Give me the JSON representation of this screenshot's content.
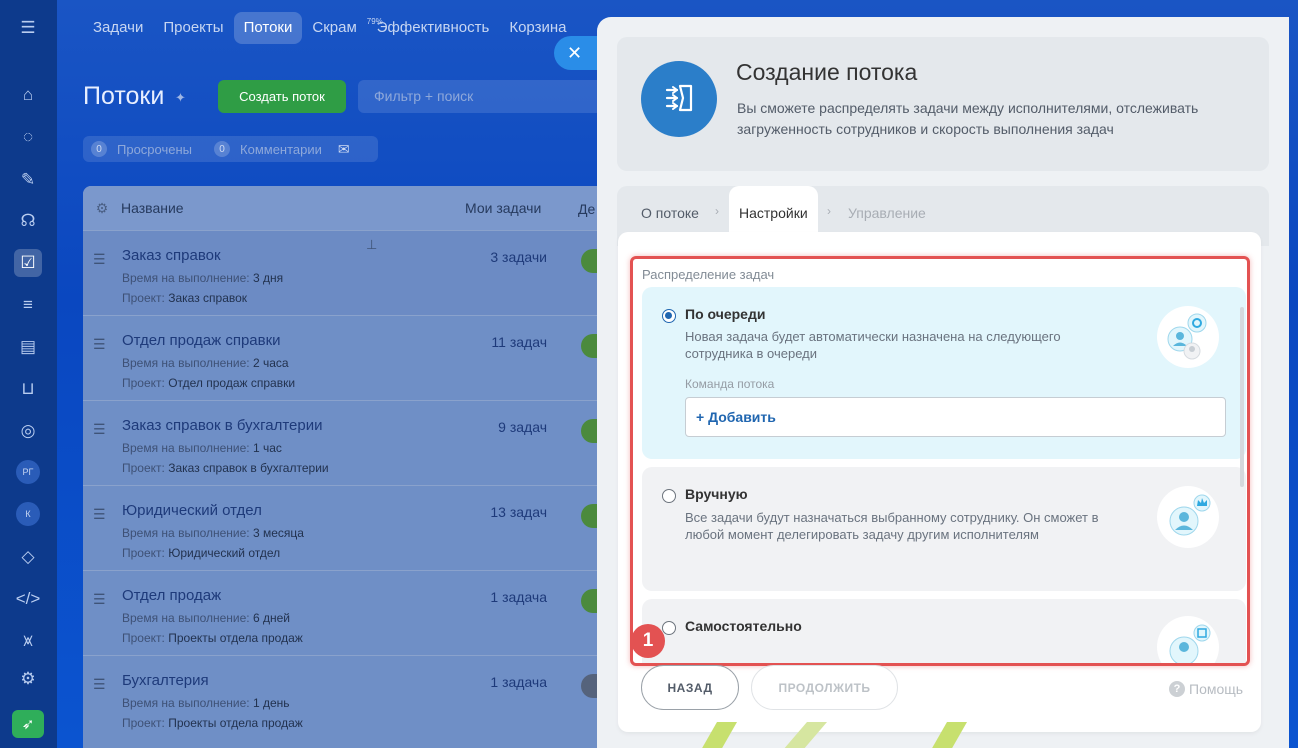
{
  "top_tabs": [
    {
      "label": "Задачи"
    },
    {
      "label": "Проекты"
    },
    {
      "label": "Потоки"
    },
    {
      "label": "Скрам"
    },
    {
      "label": "Эффективность",
      "sup": "79%"
    },
    {
      "label": "Корзина"
    }
  ],
  "rail": {
    "avatar1": "РГ",
    "avatar2": "К"
  },
  "page": {
    "title": "Потоки",
    "create_label": "Создать поток",
    "filter_placeholder": "Фильтр + поиск",
    "overdue_count": "0",
    "overdue_label": "Просрочены",
    "comments_count": "0",
    "comments_label": "Комментарии"
  },
  "grid": {
    "col_name": "Название",
    "col_mine": "Мои задачи",
    "col_de": "Де",
    "rows": [
      {
        "name": "Заказ справок",
        "time_label": "Время на выполнение:",
        "time": "3 дня",
        "project_label": "Проект:",
        "project": "Заказ справок",
        "tasks": "3 задачи"
      },
      {
        "name": "Отдел продаж справки",
        "time_label": "Время на выполнение:",
        "time": "2 часа",
        "project_label": "Проект:",
        "project": "Отдел продаж справки",
        "tasks": "11 задач"
      },
      {
        "name": "Заказ справок в бухгалтерии",
        "time_label": "Время на выполнение:",
        "time": "1 час",
        "project_label": "Проект:",
        "project": "Заказ справок в бухгалтерии",
        "tasks": "9 задач"
      },
      {
        "name": "Юридический отдел",
        "time_label": "Время на выполнение:",
        "time": "3 месяца",
        "project_label": "Проект:",
        "project": "Юридический отдел",
        "tasks": "13 задач"
      },
      {
        "name": "Отдел продаж",
        "time_label": "Время на выполнение:",
        "time": "6 дней",
        "project_label": "Проект:",
        "project": "Проекты отдела продаж",
        "tasks": "1 задача"
      },
      {
        "name": "Бухгалтерия",
        "time_label": "Время на выполнение:",
        "time": "1 день",
        "project_label": "Проект:",
        "project": "Проекты отдела продаж",
        "tasks": "1 задача"
      }
    ]
  },
  "slider": {
    "title": "Создание потока",
    "description": "Вы сможете распределять задачи между исполнителями, отслеживать загруженность сотрудников и скорость выполнения задач",
    "wizard_tabs": [
      "О потоке",
      "Настройки",
      "Управление"
    ],
    "section_label": "Распределение задач",
    "options": [
      {
        "title": "По очереди",
        "desc": "Новая задача будет автоматически назначена на следующего сотрудника в очереди",
        "selected": true
      },
      {
        "title": "Вручную",
        "desc": "Все задачи будут назначаться выбранному сотруднику. Он сможет в любой момент делегировать задачу другим исполнителям",
        "selected": false
      },
      {
        "title": "Самостоятельно",
        "desc": "",
        "selected": false
      }
    ],
    "team_label": "Команда потока",
    "add_label": "+ Добавить",
    "back_label": "НАЗАД",
    "next_label": "ПРОДОЛЖИТЬ",
    "help_label": "Помощь",
    "help_icon": "?",
    "annotation_badge": "1"
  },
  "colors": {
    "accent": "#2066b0",
    "create_green": "#2f9d45",
    "annotation_red": "#e35252",
    "selected_bg": "#e2f6fc"
  }
}
